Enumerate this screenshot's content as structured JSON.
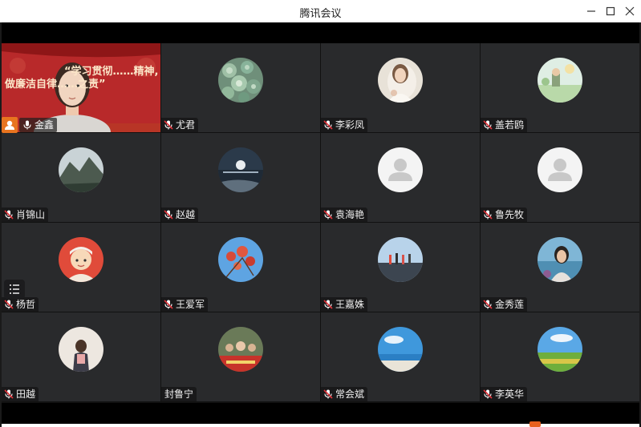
{
  "window": {
    "title": "腾讯会议"
  },
  "video": {
    "banner_line1": "“学习贯彻……精神,",
    "banner_line2": "做廉洁自律……之责”"
  },
  "participants": [
    {
      "name": "金鑫",
      "avatar": "live-video"
    },
    {
      "name": "尤君",
      "avatar": "succulent-plants"
    },
    {
      "name": "李彩凤",
      "avatar": "woman-portrait"
    },
    {
      "name": "盖若鸥",
      "avatar": "cartoon-landscape"
    },
    {
      "name": "肖锦山",
      "avatar": "mountain-landscape"
    },
    {
      "name": "赵越",
      "avatar": "moonlit-sea"
    },
    {
      "name": "袁海艳",
      "avatar": "default-avatar"
    },
    {
      "name": "鲁先牧",
      "avatar": "default-avatar"
    },
    {
      "name": "杨哲",
      "avatar": "cartoon-boy"
    },
    {
      "name": "王爱军",
      "avatar": "red-flowers-sky"
    },
    {
      "name": "王嘉姝",
      "avatar": "people-beach"
    },
    {
      "name": "金秀莲",
      "avatar": "woman-seaside"
    },
    {
      "name": "田越",
      "avatar": "child-from-behind"
    },
    {
      "name": "封鲁宁",
      "avatar": "group-photo"
    },
    {
      "name": "常会斌",
      "avatar": "blue-sky-sea"
    },
    {
      "name": "李英华",
      "avatar": "grassland-sky"
    }
  ],
  "colors": {
    "tile_bg": "#292a2c",
    "titlebar_bg": "#ffffff",
    "video_bg": "#b8292a",
    "mic_red": "#e0343a",
    "host_orange": "#e8741f"
  }
}
